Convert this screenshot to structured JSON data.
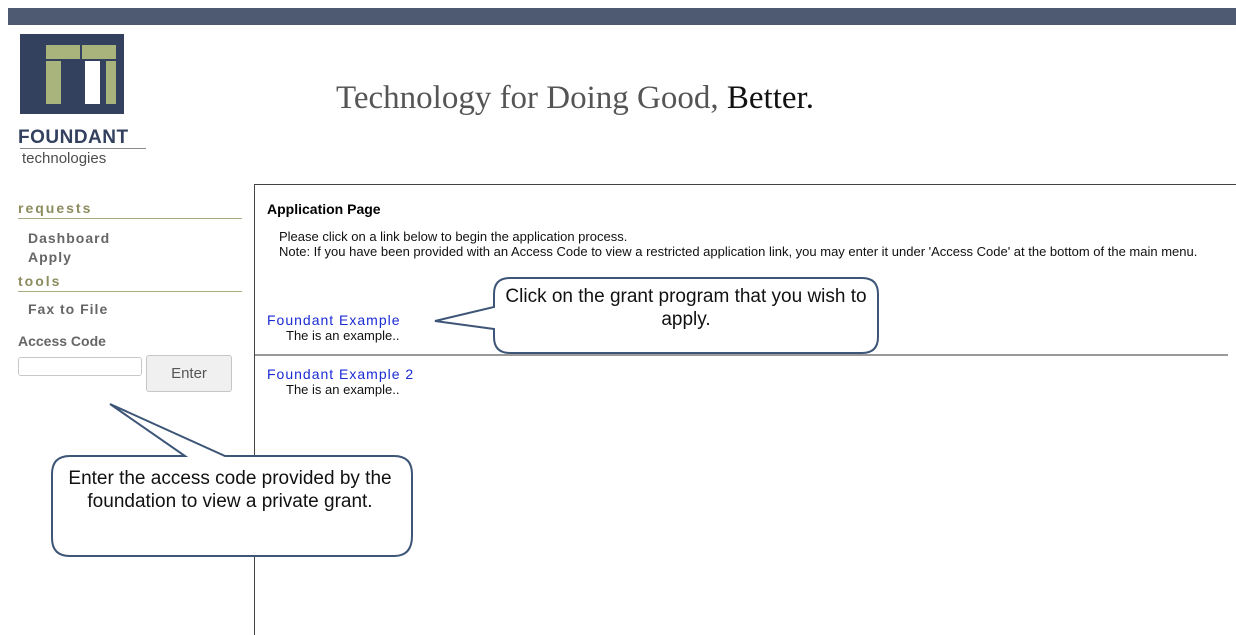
{
  "brand": {
    "logo_line1": "FOUNDANT",
    "logo_line2": "technologies",
    "tagline_main": "Technology for Doing Good,",
    "tagline_emph": "Better."
  },
  "sidebar": {
    "sections": [
      {
        "heading": "requests",
        "links": [
          "Dashboard",
          "Apply"
        ]
      },
      {
        "heading": "tools",
        "links": [
          "Fax to File"
        ]
      }
    ],
    "access_code_label": "Access Code",
    "access_code_value": "",
    "enter_button": "Enter"
  },
  "main": {
    "title": "Application Page",
    "intro_line1": "Please click on a link below to begin the application process.",
    "intro_line2": "Note: If you have been provided with an Access Code to view a restricted application link, you may enter it under 'Access Code' at the bottom of the main menu.",
    "applications": [
      {
        "name": "Foundant Example",
        "description": "The is an example.."
      },
      {
        "name": "Foundant Example 2",
        "description": "The is an example.."
      }
    ]
  },
  "callouts": {
    "grant_program": "Click on the grant program that you wish to apply.",
    "access_code": "Enter the access code provided by the foundation to view a private grant."
  },
  "colors": {
    "top_bar": "#4d5a72",
    "logo_navy": "#33415f",
    "logo_olive": "#a8b47c",
    "link_blue": "#1a2bd4",
    "callout_stroke": "#3d5577"
  }
}
